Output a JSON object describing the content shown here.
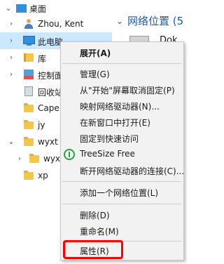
{
  "tree": {
    "desktop": "桌面",
    "user": "Zhou, Kent",
    "this_pc": "此电脑",
    "library": "库",
    "control_panel": "控制面",
    "recycle_bin": "回收站",
    "capes": "Cape",
    "jy": "jy",
    "wyxt": "wyxt",
    "wyx_sub": "wyx",
    "xp": "xp"
  },
  "right_pane": {
    "section_header": "网络位置 (5",
    "item_label": "Dok"
  },
  "context_menu": {
    "expand": "展开(A)",
    "manage": "管理(G)",
    "unpin_start": "从\"开始\"屏幕取消固定(P)",
    "map_drive": "映射网络驱动器(N)...",
    "open_new_window": "在新窗口中打开(E)",
    "pin_quick_access": "固定到快速访问",
    "treesize": "TreeSize Free",
    "disconnect_drive": "断开网络驱动器的连接(C)...",
    "add_network_location": "添加一个网络位置(L)",
    "delete": "删除(D)",
    "rename": "重命名(M)",
    "properties": "属性(R)"
  },
  "colors": {
    "selection": "#cce8ff",
    "menu_background": "#f2f2f2",
    "highlight_border": "#ff0000",
    "section_header": "#1e5aa8"
  }
}
